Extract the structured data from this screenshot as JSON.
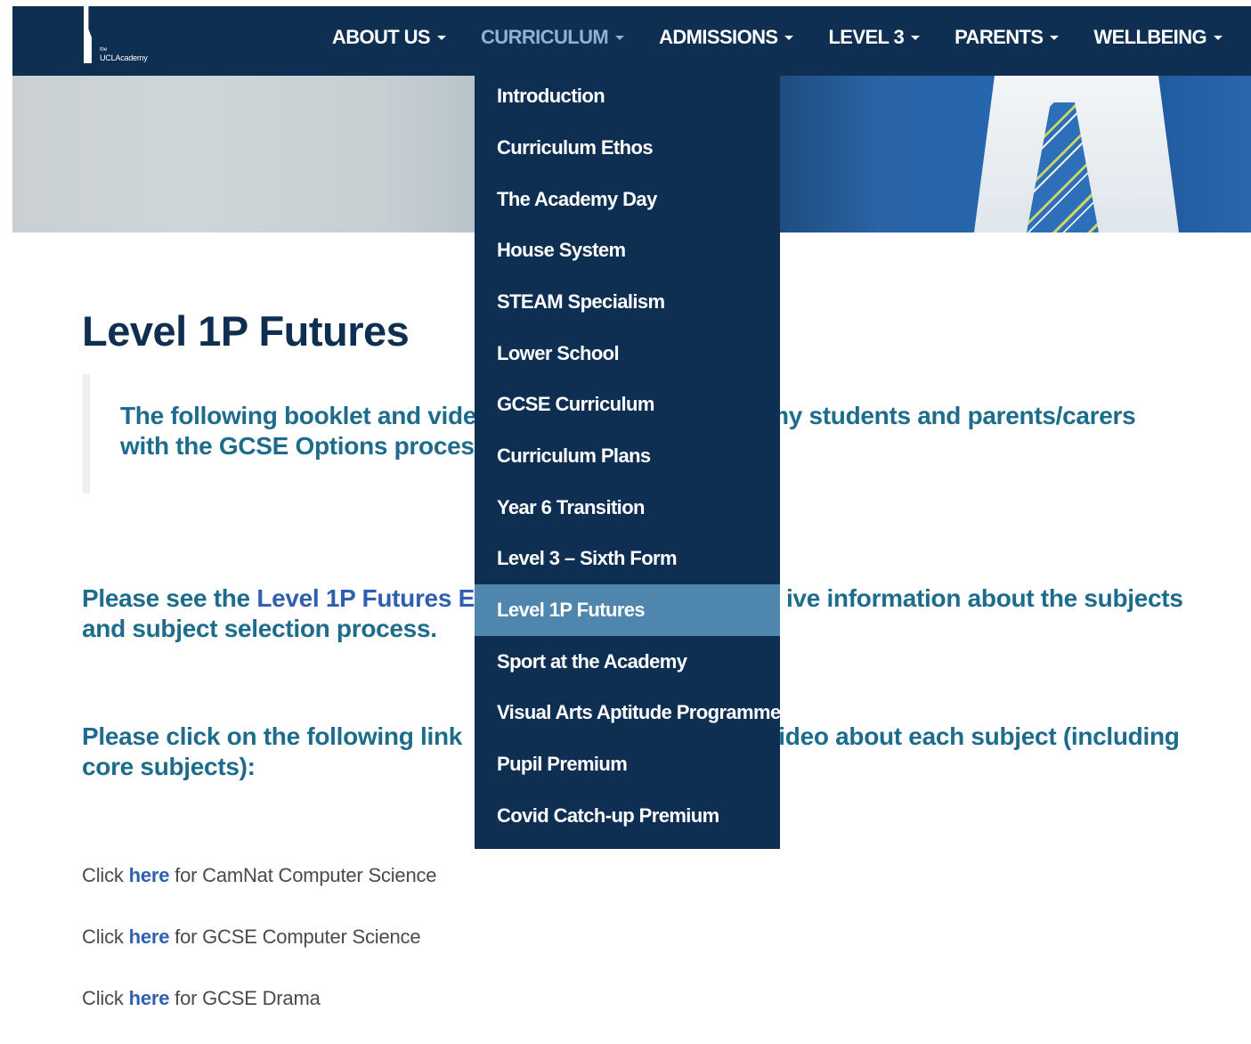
{
  "logo": {
    "small": "the",
    "name": "UCLAcademy"
  },
  "nav": [
    {
      "label": "ABOUT US"
    },
    {
      "label": "CURRICULUM",
      "active": true
    },
    {
      "label": "ADMISSIONS"
    },
    {
      "label": "LEVEL 3"
    },
    {
      "label": "PARENTS"
    },
    {
      "label": "WELLBEING"
    }
  ],
  "dropdown": {
    "items": [
      "Introduction",
      "Curriculum Ethos",
      "The Academy Day",
      "House System",
      "STEAM Specialism",
      "Lower School",
      "GCSE Curriculum",
      "Curriculum Plans",
      "Year 6 Transition",
      "Level 3 – Sixth Form",
      "Level 1P Futures",
      "Sport at the Academy",
      "Visual Arts Aptitude Programme",
      "Pupil Premium",
      "Covid Catch-up Premium"
    ],
    "active_index": 10
  },
  "content": {
    "title": "Level 1P Futures",
    "quote_line1": "The following booklet and vide",
    "quote_line1_right": "my students and parents/carers",
    "quote_line2": "with the GCSE Options proces",
    "para1_prefix": "Please see the ",
    "para1_link": "Level 1P Futures E",
    "para1_right": "ive information about the subjects",
    "para1_line2": "and subject selection process.",
    "para2_prefix": "Please click on the following link",
    "para2_right": "video about each subject (including",
    "para2_line2": "core subjects):",
    "links": [
      {
        "pre": "Click ",
        "link": "here",
        "post": " for CamNat Computer Science"
      },
      {
        "pre": "Click ",
        "link": "here",
        "post": " for GCSE Computer Science"
      },
      {
        "pre": "Click ",
        "link": "here",
        "post": " for GCSE Drama"
      }
    ]
  },
  "colors": {
    "navy": "#0e2f52",
    "teal_text": "#1e6c8c",
    "link_blue": "#2f5fb1",
    "dropdown_active": "#4f86ad"
  }
}
